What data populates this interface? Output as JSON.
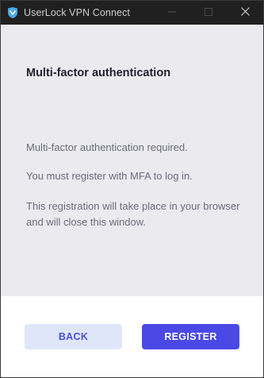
{
  "window": {
    "title": "UserLock VPN Connect",
    "app_icon": "userlock-shield-icon",
    "controls": [
      "minimize-icon",
      "maximize-icon",
      "close-icon"
    ]
  },
  "main": {
    "heading": "Multi-factor authentication",
    "messages": [
      "Multi-factor authentication required.",
      "You must register with MFA to log in.",
      "This registration will take place in your browser and will close this window."
    ]
  },
  "footer": {
    "back_label": "BACK",
    "register_label": "REGISTER"
  },
  "colors": {
    "titlebar": "#202020",
    "content_background": "#ebebef",
    "accent": "#4a49e5",
    "secondary_button": "#dfe6f9"
  }
}
